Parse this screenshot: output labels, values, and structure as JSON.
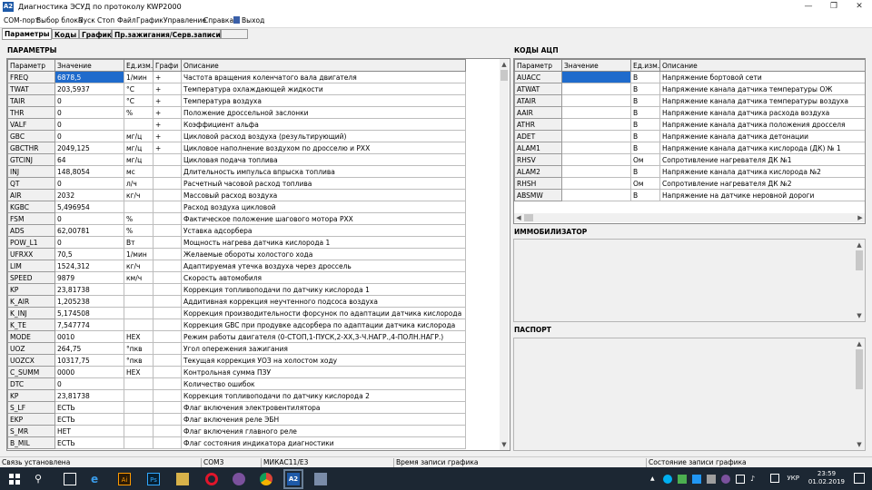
{
  "window": {
    "title": "Диагностика ЭСУД по протоколу KWP2000",
    "app_badge": "A2"
  },
  "menu": [
    "COM-порт",
    "Выбор блока",
    "Пуск",
    "Стоп",
    "Файл",
    "График",
    "Управление",
    "Справка",
    "Выход"
  ],
  "tabs": [
    "Параметры",
    "Коды",
    "График",
    "Пр.зажигания/Серв.записи"
  ],
  "params_section": "ПАРАМЕТРЫ",
  "params_columns": [
    "Параметр",
    "Значение",
    "Ед.изм.",
    "Графи",
    "Описание"
  ],
  "params_rows": [
    [
      "FREQ",
      "6878,5",
      "1/мин",
      "+",
      "Частота вращения коленчатого вала двигателя"
    ],
    [
      "TWAT",
      "203,5937",
      "°С",
      "+",
      "Температура охлаждающей жидкости"
    ],
    [
      "TAIR",
      "0",
      "°С",
      "+",
      "Температура воздуха"
    ],
    [
      "THR",
      "0",
      "%",
      "+",
      "Положение дроссельной заслонки"
    ],
    [
      "VALF",
      "0",
      "",
      "+",
      "Коэффициент альфа"
    ],
    [
      "GBC",
      "0",
      "мг/ц",
      "+",
      "Цикловой расход воздуха (результирующий)"
    ],
    [
      "GBCTHR",
      "2049,125",
      "мг/ц",
      "+",
      "Цикловое наполнение воздухом по дросселю и РХХ"
    ],
    [
      "GTCINJ",
      "64",
      "мг/ц",
      "",
      "Цикловая подача топлива"
    ],
    [
      "INJ",
      "148,8054",
      "мс",
      "",
      "Длительность импульса впрыска топлива"
    ],
    [
      "QT",
      "0",
      "л/ч",
      "",
      "Расчетный часовой расход топлива"
    ],
    [
      "AIR",
      "2032",
      "кг/ч",
      "",
      "Массовый расход воздуха"
    ],
    [
      "KGBC",
      "5,496954",
      "",
      "",
      "Расход воздуха цикловой"
    ],
    [
      "FSM",
      "0",
      "%",
      "",
      "Фактическое положение шагового мотора РХХ"
    ],
    [
      "ADS",
      "62,00781",
      "%",
      "",
      "Уставка адсорбера"
    ],
    [
      "POW_L1",
      "0",
      "Вт",
      "",
      "Мощность нагрева датчика кислорода 1"
    ],
    [
      "UFRXX",
      "70,5",
      "1/мин",
      "",
      "Желаемые обороты холостого хода"
    ],
    [
      "LIM",
      "1524,312",
      "кг/ч",
      "",
      "Адаптируемая утечка воздуха через дроссель"
    ],
    [
      "SPEED",
      "9879",
      "км/ч",
      "",
      "Скорость автомобиля"
    ],
    [
      "KP",
      "23,81738",
      "",
      "",
      "Коррекция топливоподачи по датчику кислорода 1"
    ],
    [
      "K_AIR",
      "1,205238",
      "",
      "",
      "Аддитивная коррекция неучтенного подсоса воздуха"
    ],
    [
      "K_INJ",
      "5,174508",
      "",
      "",
      "Коррекция производительности форсунок по адаптации датчика кислорода"
    ],
    [
      "K_TE",
      "7,547774",
      "",
      "",
      "Коррекция GBC при продувке адсорбера по адаптации датчика кислорода"
    ],
    [
      "MODE",
      "0010",
      "HEX",
      "",
      "Режим работы двигателя (0-СТОП,1-ПУСК,2-XX,3-Ч.НАГР.,4-ПОЛН.НАГР.)"
    ],
    [
      "UOZ",
      "264,75",
      "°пкв",
      "",
      "Угол опережения зажигания"
    ],
    [
      "UOZCX",
      "10317,75",
      "°пкв",
      "",
      "Текущая коррекция УОЗ на холостом ходу"
    ],
    [
      "C_SUMM",
      "0000",
      "HEX",
      "",
      "Контрольная сумма ПЗУ"
    ],
    [
      "DTC",
      "0",
      "",
      "",
      "Количество ошибок"
    ],
    [
      "KP",
      "23,81738",
      "",
      "",
      "Коррекция топливоподачи по датчику кислорода 2"
    ],
    [
      "S_LF",
      "ЕСТЬ",
      "",
      "",
      "Флаг включения электровентилятора"
    ],
    [
      "EKP",
      "ЕСТЬ",
      "",
      "",
      "Флаг включения реле ЭБН"
    ],
    [
      "S_MR",
      "НЕТ",
      "",
      "",
      "Флаг включения главного реле"
    ],
    [
      "B_MIL",
      "ЕСТЬ",
      "",
      "",
      "Флаг состояния индикатора диагностики"
    ]
  ],
  "adc_section": "КОДЫ АЦП",
  "adc_columns": [
    "Параметр",
    "Значение",
    "Ед.изм.",
    "Описание"
  ],
  "adc_rows": [
    [
      "AUACC",
      "",
      "В",
      "Напряжение бортовой сети"
    ],
    [
      "ATWAT",
      "",
      "В",
      "Напряжение канала датчика температуры ОЖ"
    ],
    [
      "ATAIR",
      "",
      "В",
      "Напряжение канала датчика температуры воздуха"
    ],
    [
      "AAIR",
      "",
      "В",
      "Напряжение канала датчика расхода воздуха"
    ],
    [
      "ATHR",
      "",
      "В",
      "Напряжение канала датчика положения дросселя"
    ],
    [
      "ADET",
      "",
      "В",
      "Напряжение канала датчика детонации"
    ],
    [
      "ALAM1",
      "",
      "В",
      "Напряжение канала датчика кислорода (ДК) № 1"
    ],
    [
      "RHSV",
      "",
      "Ом",
      "Сопротивление нагревателя ДК №1"
    ],
    [
      "ALAM2",
      "",
      "В",
      "Напряжение канала датчика кислорода №2"
    ],
    [
      "RHSH",
      "",
      "Ом",
      "Сопротивление нагревателя ДК №2"
    ],
    [
      "ABSMW",
      "",
      "В",
      "Напряжение на датчике неровной дороги"
    ]
  ],
  "immo_section": "ИММОБИЛИЗАТОР",
  "passport_section": "ПАСПОРТ",
  "status": [
    "Связь установлена",
    "COM3",
    "МИКАС11/Е3",
    "Время записи графика",
    "Состояние записи графика"
  ],
  "taskbar": {
    "lang": "УКР",
    "time": "23:59",
    "date": "01.02.2019",
    "pinned_badge": "A2"
  },
  "colors": {
    "selection": "#1f6bcc",
    "taskbar": "#1c2733"
  }
}
